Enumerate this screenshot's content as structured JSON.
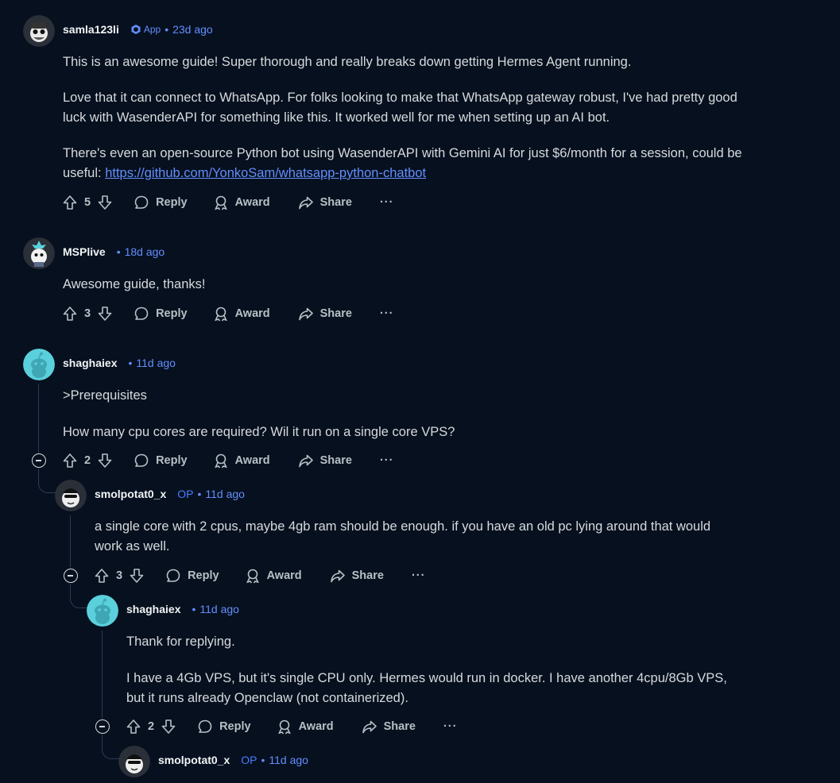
{
  "comments": [
    {
      "username": "samla123li",
      "badge": "App",
      "time": "23d ago",
      "paragraphs": [
        "This is an awesome guide! Super thorough and really breaks down getting Hermes Agent running.",
        "Love that it can connect to WhatsApp. For folks looking to make that WhatsApp gateway robust, I've had pretty good luck with WasenderAPI for something like this. It worked well for me when setting up an AI bot.",
        "There's even an open-source Python bot using WasenderAPI with Gemini AI for just $6/month for a session, could be useful: "
      ],
      "link": "https://github.com/YonkoSam/whatsapp-python-chatbot",
      "votes": "5"
    },
    {
      "username": "MSPlive",
      "time": "18d ago",
      "paragraphs": [
        "Awesome guide, thanks!"
      ],
      "votes": "3"
    },
    {
      "username": "shaghaiex",
      "time": "11d ago",
      "paragraphs": [
        ">Prerequisites",
        "How many cpu cores are required? Wil it run on a single core VPS?"
      ],
      "votes": "2"
    },
    {
      "username": "smolpotat0_x",
      "op": "OP",
      "time": "11d ago",
      "paragraphs": [
        "a single core with 2 cpus, maybe 4gb ram should be enough. if you have an old pc lying around that would work as well."
      ],
      "votes": "3"
    },
    {
      "username": "shaghaiex",
      "time": "11d ago",
      "paragraphs": [
        "Thank for replying.",
        "I have a 4Gb VPS, but it's single CPU only. Hermes would run in docker.  I have another 4cpu/8Gb VPS, but it runs already Openclaw (not containerized)."
      ],
      "votes": "2"
    },
    {
      "username": "smolpotat0_x",
      "op": "OP",
      "time": "11d ago"
    }
  ],
  "labels": {
    "reply": "Reply",
    "award": "Award",
    "share": "Share",
    "more": "···",
    "dot": "•"
  },
  "colors": {
    "background": "#06101f",
    "link": "#648efc",
    "op": "#4a7cff",
    "avatar_cyan": "#5bd0dd"
  }
}
